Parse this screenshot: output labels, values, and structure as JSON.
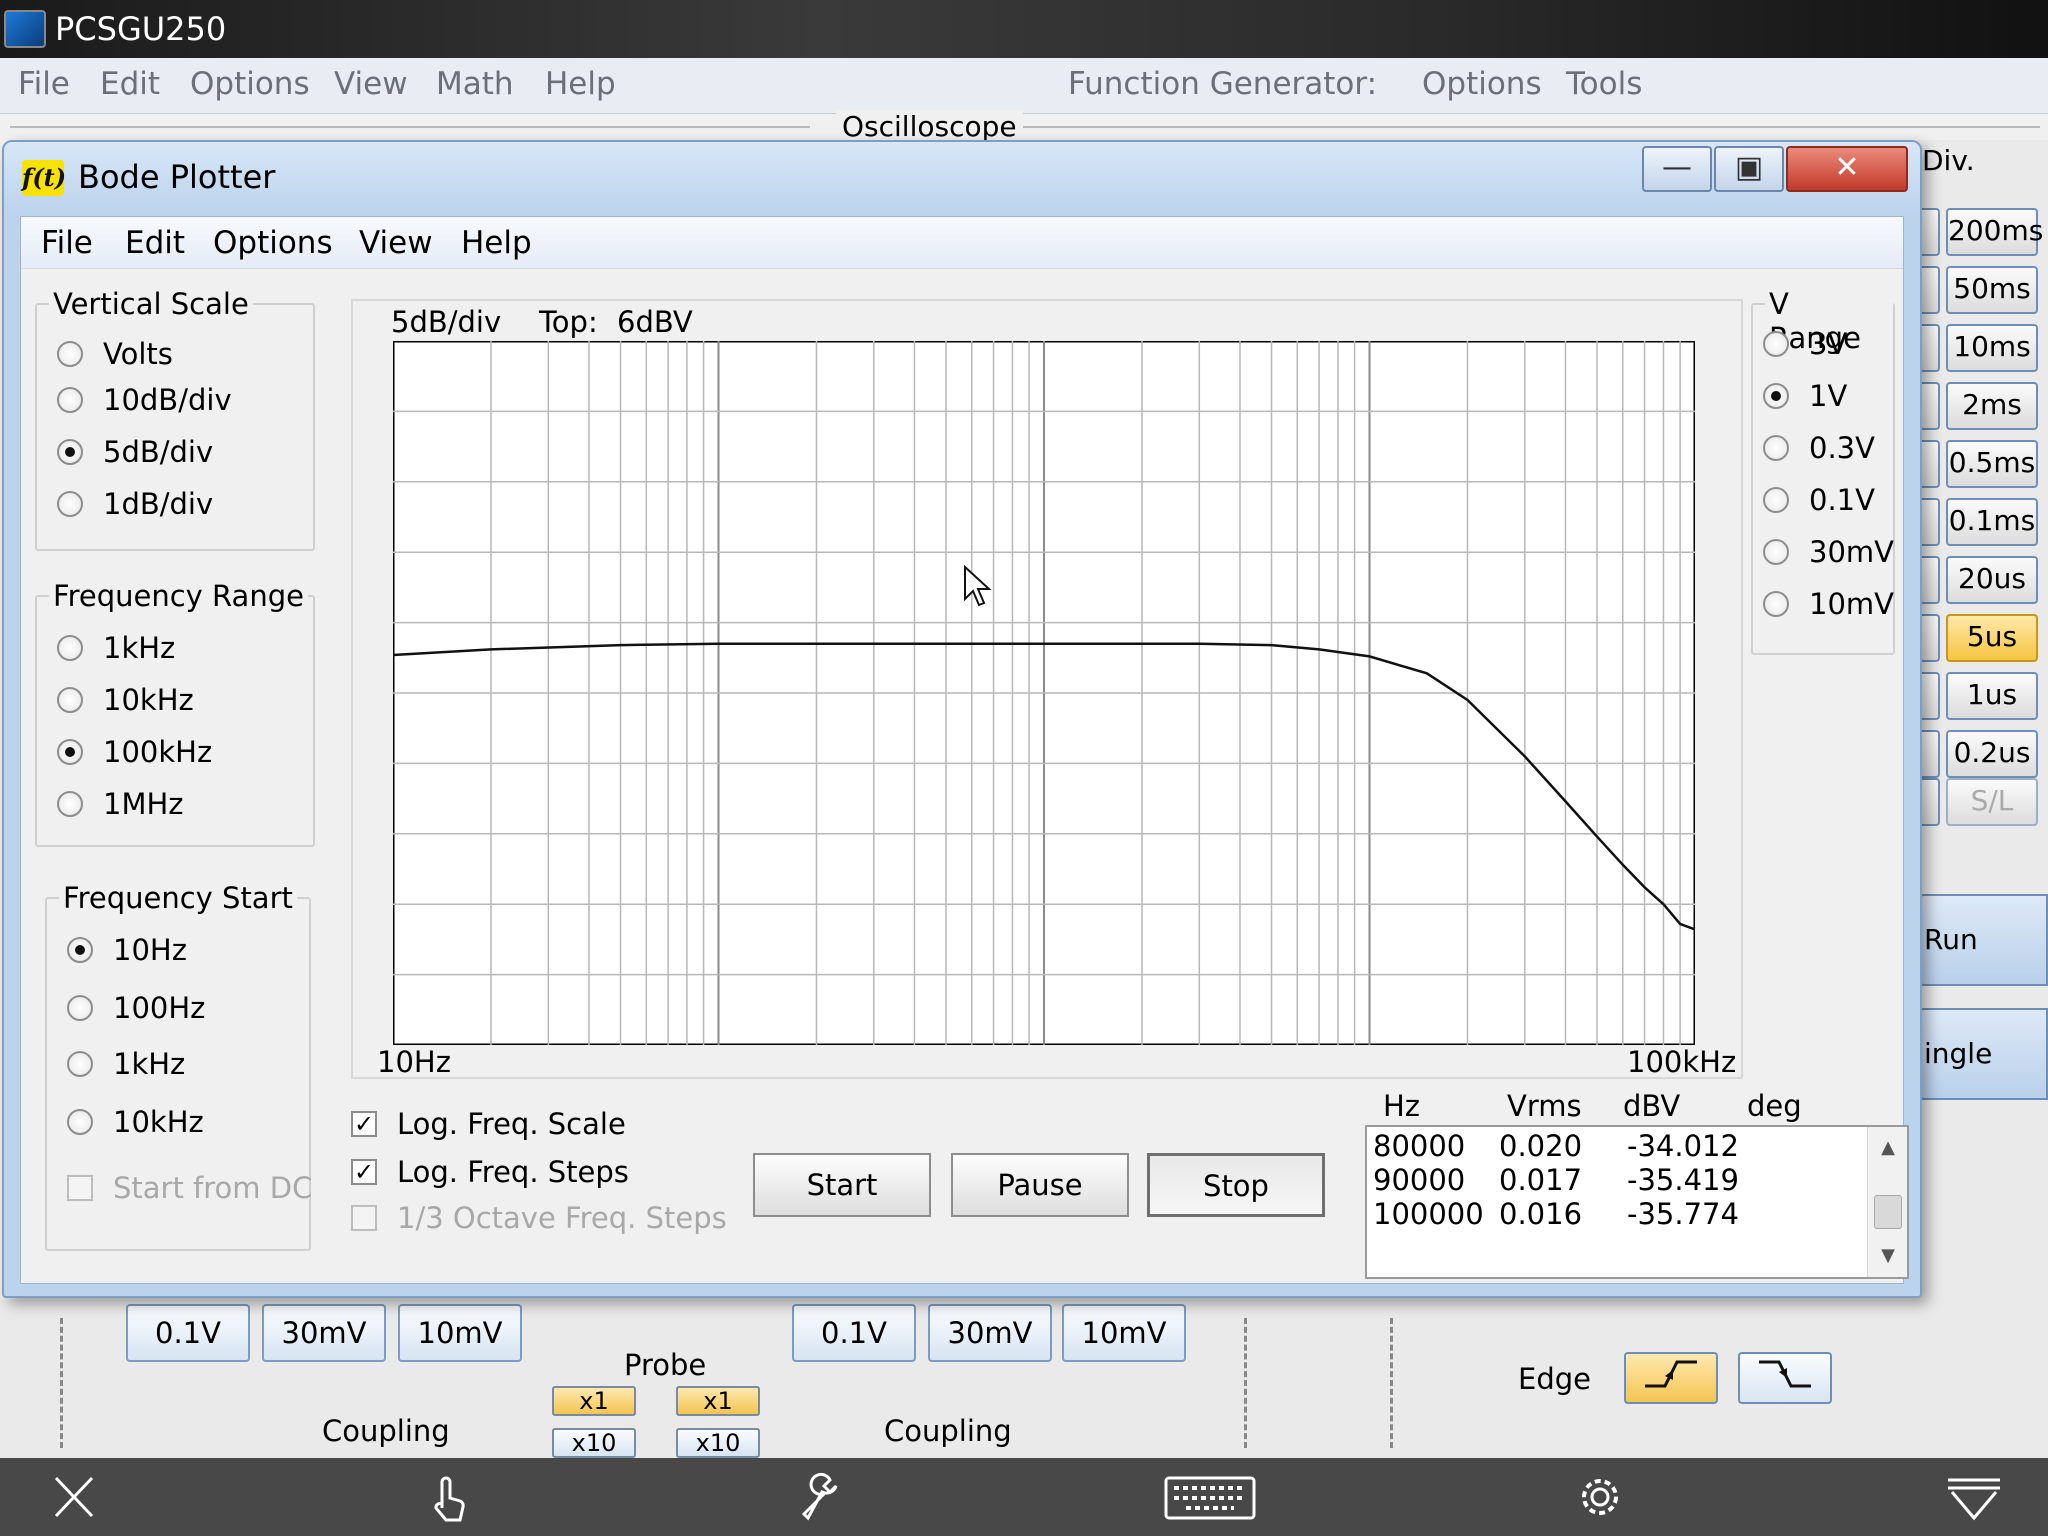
{
  "app": {
    "title": "PCSGU250",
    "menu": [
      "File",
      "Edit",
      "Options",
      "View",
      "Math",
      "Help"
    ],
    "fg_label": "Function Generator:",
    "fg_menu": [
      "Options",
      "Tools"
    ],
    "oscilloscope_label": "Oscilloscope",
    "time_div_label": "Div.",
    "time_buttons": [
      "200ms",
      "50ms",
      "10ms",
      "2ms",
      "0.5ms",
      "0.1ms",
      "20us",
      "5us",
      "1us",
      "0.2us",
      "S/L"
    ],
    "time_active": "5us",
    "run_label": "Run",
    "single_label": "ingle",
    "ch1_volts": [
      "0.1V",
      "30mV",
      "10mV"
    ],
    "ch2_volts": [
      "0.1V",
      "30mV",
      "10mV"
    ],
    "probe_label": "Probe",
    "probe_buttons": [
      "x1",
      "x1",
      "x10",
      "x10"
    ],
    "coupling_label": "Coupling",
    "edge_label": "Edge"
  },
  "bode": {
    "title": "Bode Plotter",
    "icon_text": "f(t)",
    "menu": [
      "File",
      "Edit",
      "Options",
      "View",
      "Help"
    ],
    "vertical_scale": {
      "label": "Vertical Scale",
      "options": [
        "Volts",
        "10dB/div",
        "5dB/div",
        "1dB/div"
      ],
      "selected": 2
    },
    "frequency_range": {
      "label": "Frequency Range",
      "options": [
        "1kHz",
        "10kHz",
        "100kHz",
        "1MHz"
      ],
      "selected": 2
    },
    "frequency_start": {
      "label": "Frequency Start",
      "options": [
        "10Hz",
        "100Hz",
        "1kHz",
        "10kHz"
      ],
      "selected": 0,
      "start_from_dc": "Start from DC"
    },
    "v_range": {
      "label": "V Range",
      "options": [
        "3V",
        "1V",
        "0.3V",
        "0.1V",
        "30mV",
        "10mV"
      ],
      "selected": 1
    },
    "plot": {
      "scale_text": "5dB/div",
      "top_label": "Top:",
      "top_value": "6dBV",
      "x_start": "10Hz",
      "x_end": "100kHz"
    },
    "checks": [
      {
        "label": "Log. Freq. Scale",
        "checked": true,
        "disabled": false
      },
      {
        "label": "Log. Freq. Steps",
        "checked": true,
        "disabled": false
      },
      {
        "label": "1/3 Octave Freq. Steps",
        "checked": false,
        "disabled": true
      }
    ],
    "buttons": {
      "start": "Start",
      "pause": "Pause",
      "stop": "Stop"
    },
    "table": {
      "headers": [
        "Hz",
        "Vrms",
        "dBV",
        "deg"
      ],
      "rows": [
        [
          "80000",
          "0.020",
          "-34.012"
        ],
        [
          "90000",
          "0.017",
          "-35.419"
        ],
        [
          "100000",
          "0.016",
          "-35.774"
        ]
      ]
    }
  },
  "chart_data": {
    "type": "line",
    "xscale": "log",
    "xlim": [
      10,
      100000
    ],
    "ylim": [
      -44,
      6
    ],
    "grid": true,
    "series": [
      {
        "x": [
          10,
          20,
          50,
          100,
          200,
          500,
          1000,
          2000,
          3000,
          5000,
          7000,
          10000,
          15000,
          20000,
          30000,
          40000,
          50000,
          60000,
          70000,
          80000,
          90000,
          100000
        ],
        "y": [
          -16.3,
          -15.9,
          -15.6,
          -15.5,
          -15.5,
          -15.5,
          -15.5,
          -15.5,
          -15.5,
          -15.6,
          -15.9,
          -16.4,
          -17.6,
          -19.5,
          -23.5,
          -26.7,
          -29.2,
          -31.2,
          -32.8,
          -34.0,
          -35.4,
          -35.8
        ]
      }
    ]
  },
  "taskbar": {
    "icons": [
      "close-icon",
      "touch-icon",
      "wrench-icon",
      "keyboard-icon",
      "gear-icon",
      "menu-down-icon"
    ]
  }
}
